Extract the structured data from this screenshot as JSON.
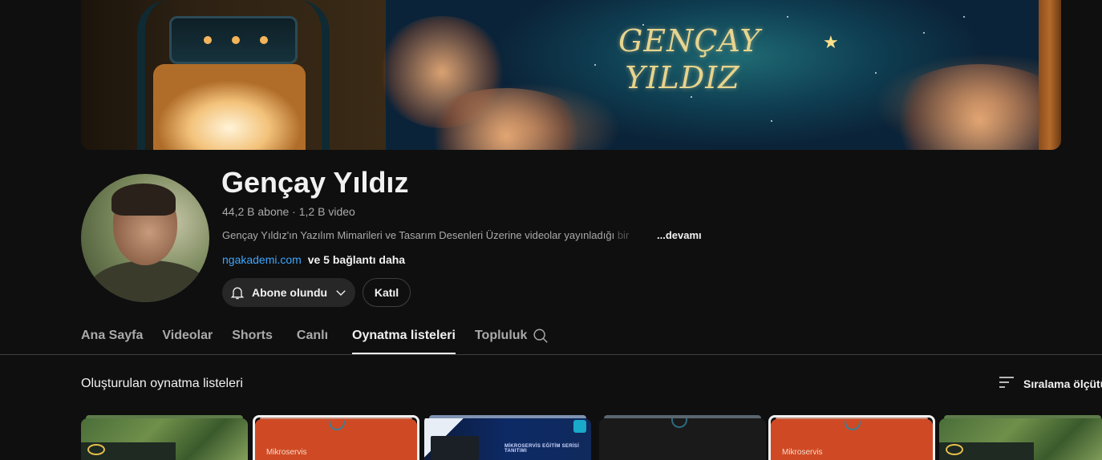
{
  "banner": {
    "logo_text_line1": "GENÇAY",
    "logo_text_line2": "YILDIZ"
  },
  "channel": {
    "name": "Gençay Yıldız",
    "subscribers": "44,2 B abone",
    "separator": " · ",
    "videos": "1,2 B video",
    "description": "Gençay Yıldız'ın Yazılım Mimarileri ve Tasarım Desenleri Üzerine videolar yayınladığı",
    "description_fade": " bir",
    "more_label": "...devamı",
    "link": "ngakademi.com",
    "more_links": "ve 5 bağlantı daha"
  },
  "buttons": {
    "subscribed": "Abone olundu",
    "join": "Katıl"
  },
  "tabs": [
    {
      "label": "Ana Sayfa",
      "active": false
    },
    {
      "label": "Videolar",
      "active": false
    },
    {
      "label": "Shorts",
      "active": false
    },
    {
      "label": "Canlı",
      "active": false
    },
    {
      "label": "Oynatma listeleri",
      "active": true
    },
    {
      "label": "Topluluk",
      "active": false
    }
  ],
  "section": {
    "title": "Oluşturulan oynatma listeleri",
    "sort_label": "Sıralama ölçütü"
  },
  "thumbnails": [
    {
      "style": "green"
    },
    {
      "style": "orange",
      "text": "Mikroservis"
    },
    {
      "style": "blue",
      "text": "MİKROSERVİS EĞİTİM SERİSİ TANITIMI"
    },
    {
      "style": "dark"
    },
    {
      "style": "orange",
      "text": "Mikroservis"
    },
    {
      "style": "green"
    }
  ],
  "icons": {
    "subscribe": "bell-icon",
    "dropdown": "chevron-down-icon",
    "search": "search-icon",
    "sort": "sort-icon"
  },
  "colors": {
    "background": "#0f0f0f",
    "link": "#3ea6ff",
    "button": "#272727",
    "text_secondary": "#aaaaaa"
  }
}
